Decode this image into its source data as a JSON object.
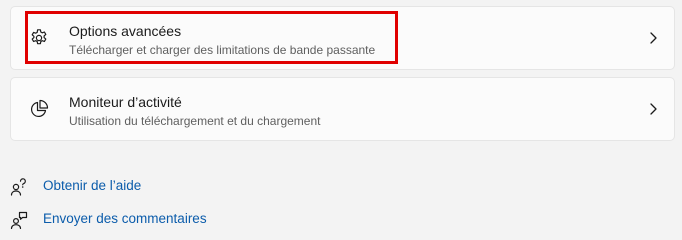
{
  "cards": [
    {
      "title": "Options avancées",
      "subtitle": "Télécharger et charger des limitations de bande passante",
      "icon": "gear-icon"
    },
    {
      "title": "Moniteur d’activité",
      "subtitle": "Utilisation du téléchargement et du chargement",
      "icon": "pie-chart-icon"
    }
  ],
  "links": [
    {
      "label": "Obtenir de l’aide",
      "icon": "help-person-icon"
    },
    {
      "label": "Envoyer des commentaires",
      "icon": "feedback-person-icon"
    }
  ],
  "colors": {
    "highlight": "#e00000",
    "link": "#0b5cab",
    "card_bg": "#fbfbfb",
    "page_bg": "#f3f3f3"
  }
}
